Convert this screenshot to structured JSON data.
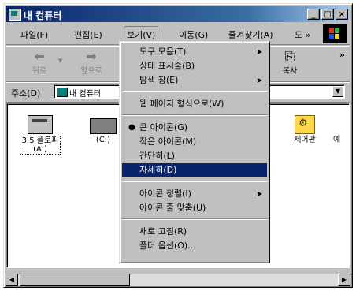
{
  "window": {
    "title": "내 컴퓨터",
    "controls": {
      "minimize": "_",
      "maximize": "□",
      "close": "×"
    }
  },
  "menubar": {
    "items": [
      "파일(F)",
      "편집(E)",
      "보기(V)",
      "이동(G)",
      "즐겨찾기(A)",
      "도 »"
    ]
  },
  "toolbar": {
    "back_label": "뒤로",
    "forward_label": "앞으로",
    "copy_label": "복사",
    "more": "»"
  },
  "address": {
    "label": "주소(D)",
    "value": "내 컴퓨터",
    "dropdown_glyph": "▼"
  },
  "items": [
    {
      "label": "3.5 플로피\n(A:)",
      "icon": "floppy-drive-icon"
    },
    {
      "label": "(C:)",
      "icon": "hard-drive-icon"
    },
    {
      "label": "제어판",
      "icon": "control-panel-icon"
    },
    {
      "label": "예",
      "icon": ""
    }
  ],
  "view_menu": {
    "items": [
      {
        "label": "도구 모음(T)",
        "submenu": true
      },
      {
        "label": "상태 표시줄(B)"
      },
      {
        "label": "탐색 창(E)",
        "submenu": true
      },
      {
        "label": "웹 페이지 형식으로(W)"
      },
      {
        "label": "큰 아이콘(G)",
        "checked": true
      },
      {
        "label": "작은 아이콘(M)"
      },
      {
        "label": "간단히(L)"
      },
      {
        "label": "자세히(D)",
        "highlighted": true
      },
      {
        "label": "아이콘 정렬(I)",
        "submenu": true
      },
      {
        "label": "아이콘 줄 맞춤(U)"
      },
      {
        "label": "새로 고침(R)"
      },
      {
        "label": "폴더 옵션(O)..."
      }
    ],
    "submenu_glyph": "▶",
    "check_glyph": "●"
  },
  "scrollbar": {
    "left_glyph": "◀",
    "right_glyph": "▶"
  },
  "colors": {
    "title_bar": "#0a246a",
    "highlight": "#0a246a",
    "face": "#c0c0c0"
  }
}
